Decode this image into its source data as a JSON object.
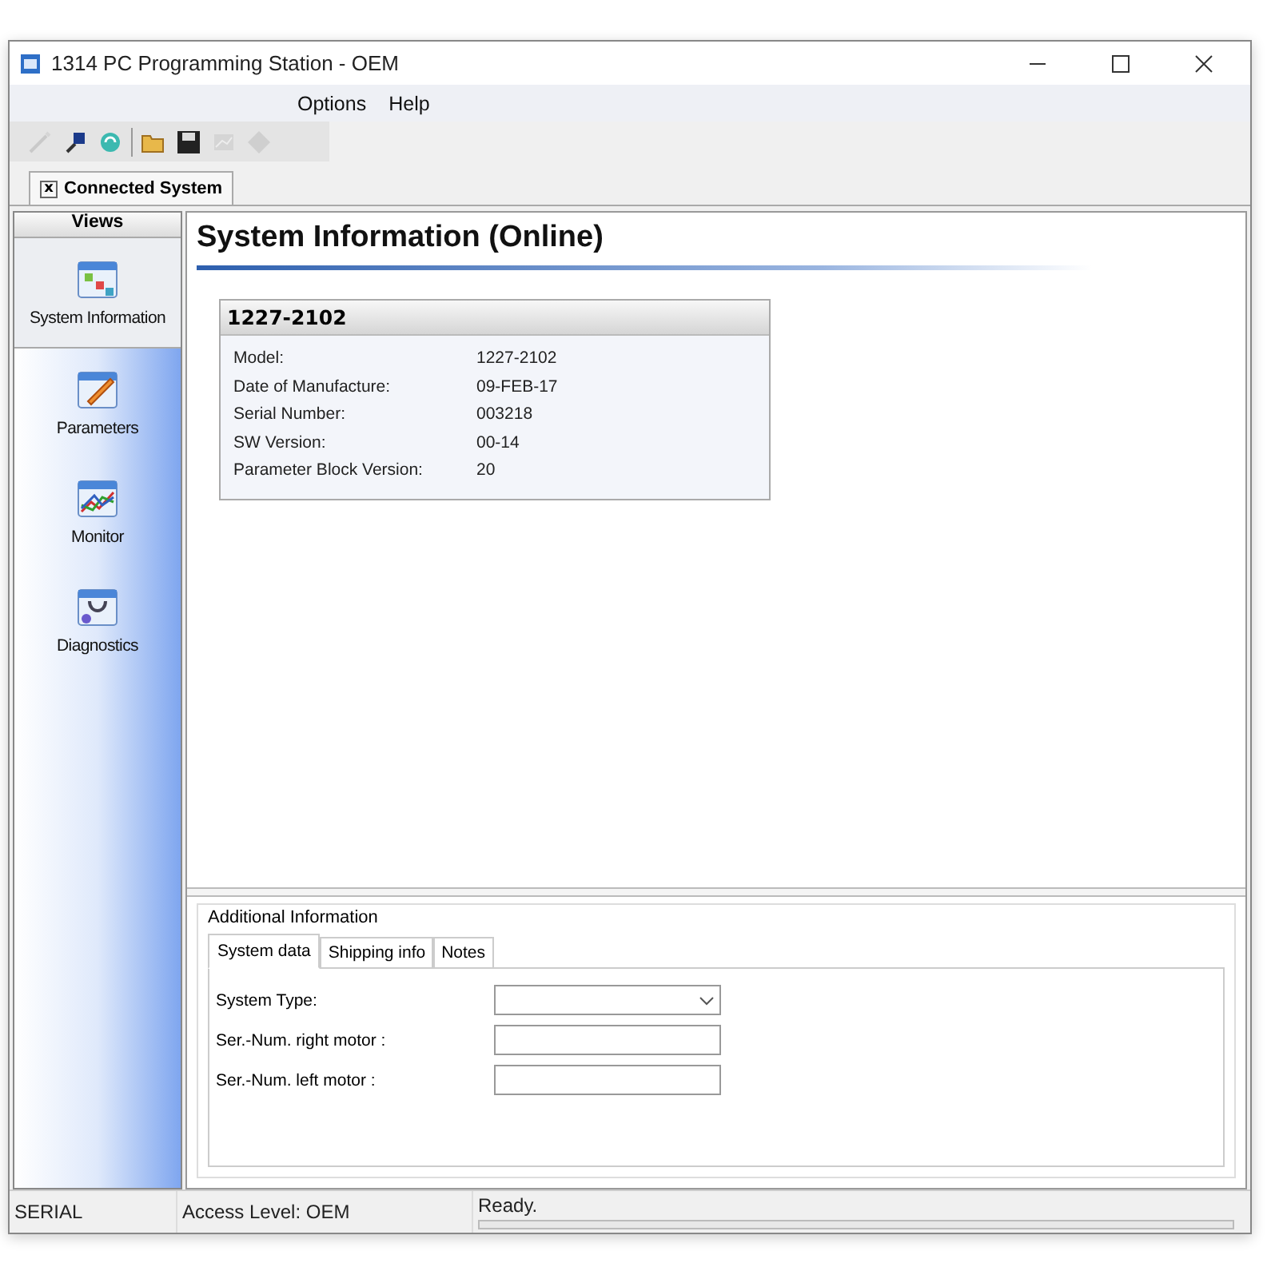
{
  "window": {
    "title": "1314 PC Programming Station - OEM"
  },
  "menu": [
    {
      "label": "Options"
    },
    {
      "label": "Help"
    }
  ],
  "toolbar": [
    {
      "kind": "wand",
      "disabled": true
    },
    {
      "kind": "plug",
      "disabled": false
    },
    {
      "kind": "refresh",
      "disabled": false
    },
    {
      "kind": "open",
      "disabled": false
    },
    {
      "kind": "save",
      "disabled": false
    },
    {
      "kind": "chart",
      "disabled": true
    },
    {
      "kind": "diamond",
      "disabled": true
    }
  ],
  "document_tab": {
    "close": "x",
    "label": "Connected System"
  },
  "sidebar": {
    "header": "Views",
    "items": [
      {
        "label": "System Information",
        "selected": true
      },
      {
        "label": "Parameters",
        "selected": false
      },
      {
        "label": "Monitor",
        "selected": false
      },
      {
        "label": "Diagnostics",
        "selected": false
      }
    ]
  },
  "page_title": "System Information (Online)",
  "info_card": {
    "title": "1227-2102",
    "rows": [
      {
        "label": "Model:",
        "value": "1227-2102"
      },
      {
        "label": "Date of Manufacture:",
        "value": "09-FEB-17"
      },
      {
        "label": "Serial Number:",
        "value": "003218"
      },
      {
        "label": "SW Version:",
        "value": "00-14"
      },
      {
        "label": "Parameter Block Version:",
        "value": "20"
      }
    ]
  },
  "additional": {
    "title": "Additional Information",
    "tabs": [
      {
        "label": "System data",
        "selected": true
      },
      {
        "label": "Shipping info",
        "selected": false
      },
      {
        "label": "Notes",
        "selected": false
      }
    ],
    "fields": [
      {
        "label": "System Type:",
        "kind": "dropdown"
      },
      {
        "label": "Ser.-Num.  right motor :",
        "kind": "text"
      },
      {
        "label": "Ser.-Num.  left motor :",
        "kind": "text"
      }
    ]
  },
  "status_bar": {
    "port": "SERIAL",
    "access": "Access Level: OEM",
    "status": "Ready.",
    "level": 0
  }
}
